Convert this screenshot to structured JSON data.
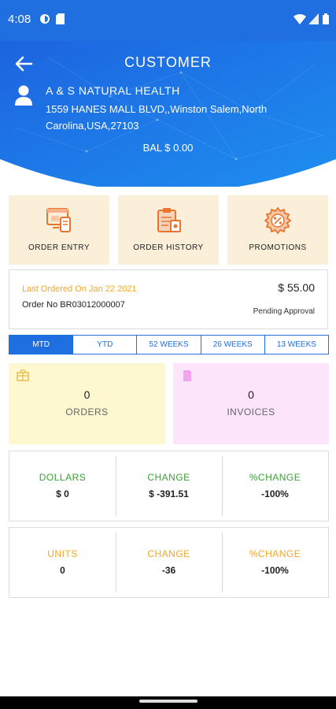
{
  "status_bar": {
    "time": "4:08"
  },
  "header": {
    "title": "CUSTOMER",
    "customer_name": "A & S NATURAL HEALTH",
    "address": "1559 HANES MALL BLVD,,Winston Salem,North Carolina,USA,27103",
    "balance": "BAL $ 0.00"
  },
  "actions": [
    {
      "label": "ORDER ENTRY",
      "icon": "order-entry-icon"
    },
    {
      "label": "ORDER HISTORY",
      "icon": "order-history-icon"
    },
    {
      "label": "PROMOTIONS",
      "icon": "promotions-icon"
    }
  ],
  "last_order": {
    "date_text": "Last Ordered On Jan 22 2021",
    "order_no": "Order No BR03012000007",
    "amount": "$ 55.00",
    "status": "Pending Approval"
  },
  "period_tabs": [
    "MTD",
    "YTD",
    "52 WEEKS",
    "26 WEEKS",
    "13 WEEKS"
  ],
  "active_tab": "MTD",
  "stats": {
    "orders": {
      "value": "0",
      "label": "ORDERS",
      "icon": "orders-icon"
    },
    "invoices": {
      "value": "0",
      "label": "INVOICES",
      "icon": "invoice-icon"
    }
  },
  "dollars_table": {
    "headers": [
      "DOLLARS",
      "CHANGE",
      "%CHANGE"
    ],
    "values": [
      "$ 0",
      "$ -391.51",
      "-100%"
    ]
  },
  "units_table": {
    "headers": [
      "UNITS",
      "CHANGE",
      "%CHANGE"
    ],
    "values": [
      "0",
      "-36",
      "-100%"
    ]
  },
  "colors": {
    "primary": "#1f6fe0",
    "tile_bg": "#fcefda",
    "orders_bg": "#fdf8cf",
    "invoices_bg": "#fce4fb",
    "green": "#3aa335",
    "orange": "#f5a623"
  }
}
